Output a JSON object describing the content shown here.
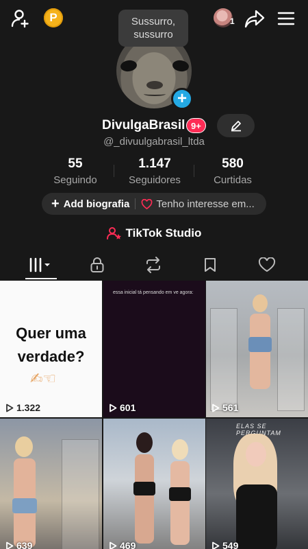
{
  "topbar": {
    "add_user_icon": "add-user-icon",
    "coin_label": "P",
    "account_count": "1",
    "share_icon": "share-icon",
    "menu_icon": "hamburger-menu-icon"
  },
  "tooltip": {
    "line1": "Sussurro,",
    "line2": "sussurro"
  },
  "profile": {
    "display_name": "DivulgaBrasil",
    "badge": "9+",
    "username": "@_divuulgabrasil_ltda"
  },
  "stats": [
    {
      "value": "55",
      "label": "Seguindo"
    },
    {
      "value": "1.147",
      "label": "Seguidores"
    },
    {
      "value": "580",
      "label": "Curtidas"
    }
  ],
  "bio": {
    "add_label": "Add biografia",
    "interest_label": "Tenho interesse em..."
  },
  "studio": {
    "label": "TikTok Studio"
  },
  "tabs": [
    "videos-grid",
    "private",
    "reposts",
    "favorites",
    "liked"
  ],
  "grid": [
    {
      "views": "1.322",
      "headline_1": "Quer uma",
      "headline_2": "verdade?"
    },
    {
      "views": "601",
      "caption": "essa inicial tá pensando em ve agora:"
    },
    {
      "views": "561"
    },
    {
      "views": "639"
    },
    {
      "views": "469"
    },
    {
      "views": "549",
      "caption": "ELAS SE PERGUNTAM"
    }
  ],
  "colors": {
    "background": "#181818",
    "accent_pink": "#fe2c55",
    "accent_blue": "#24a9e4",
    "coin": "#f5b21b"
  }
}
